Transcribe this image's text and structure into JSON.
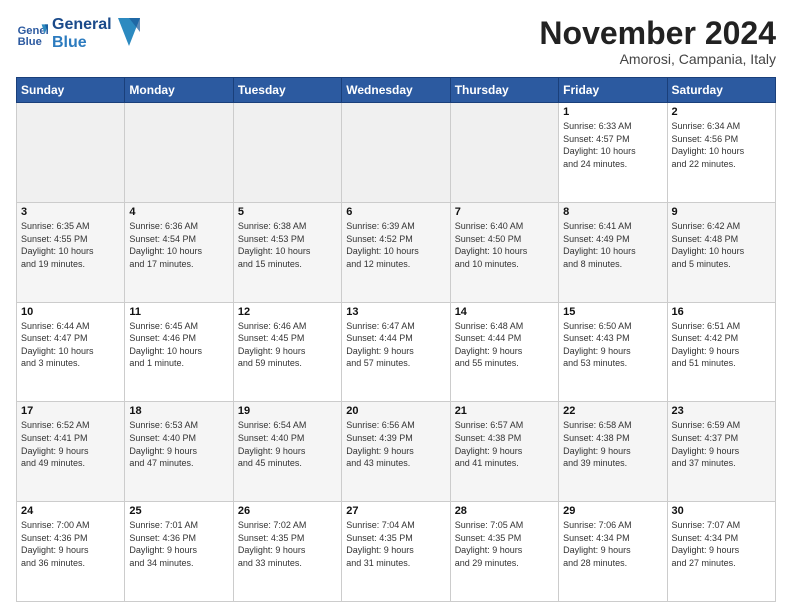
{
  "logo": {
    "line1": "General",
    "line2": "Blue"
  },
  "title": "November 2024",
  "subtitle": "Amorosi, Campania, Italy",
  "days_of_week": [
    "Sunday",
    "Monday",
    "Tuesday",
    "Wednesday",
    "Thursday",
    "Friday",
    "Saturday"
  ],
  "weeks": [
    [
      {
        "day": "",
        "detail": ""
      },
      {
        "day": "",
        "detail": ""
      },
      {
        "day": "",
        "detail": ""
      },
      {
        "day": "",
        "detail": ""
      },
      {
        "day": "",
        "detail": ""
      },
      {
        "day": "1",
        "detail": "Sunrise: 6:33 AM\nSunset: 4:57 PM\nDaylight: 10 hours\nand 24 minutes."
      },
      {
        "day": "2",
        "detail": "Sunrise: 6:34 AM\nSunset: 4:56 PM\nDaylight: 10 hours\nand 22 minutes."
      }
    ],
    [
      {
        "day": "3",
        "detail": "Sunrise: 6:35 AM\nSunset: 4:55 PM\nDaylight: 10 hours\nand 19 minutes."
      },
      {
        "day": "4",
        "detail": "Sunrise: 6:36 AM\nSunset: 4:54 PM\nDaylight: 10 hours\nand 17 minutes."
      },
      {
        "day": "5",
        "detail": "Sunrise: 6:38 AM\nSunset: 4:53 PM\nDaylight: 10 hours\nand 15 minutes."
      },
      {
        "day": "6",
        "detail": "Sunrise: 6:39 AM\nSunset: 4:52 PM\nDaylight: 10 hours\nand 12 minutes."
      },
      {
        "day": "7",
        "detail": "Sunrise: 6:40 AM\nSunset: 4:50 PM\nDaylight: 10 hours\nand 10 minutes."
      },
      {
        "day": "8",
        "detail": "Sunrise: 6:41 AM\nSunset: 4:49 PM\nDaylight: 10 hours\nand 8 minutes."
      },
      {
        "day": "9",
        "detail": "Sunrise: 6:42 AM\nSunset: 4:48 PM\nDaylight: 10 hours\nand 5 minutes."
      }
    ],
    [
      {
        "day": "10",
        "detail": "Sunrise: 6:44 AM\nSunset: 4:47 PM\nDaylight: 10 hours\nand 3 minutes."
      },
      {
        "day": "11",
        "detail": "Sunrise: 6:45 AM\nSunset: 4:46 PM\nDaylight: 10 hours\nand 1 minute."
      },
      {
        "day": "12",
        "detail": "Sunrise: 6:46 AM\nSunset: 4:45 PM\nDaylight: 9 hours\nand 59 minutes."
      },
      {
        "day": "13",
        "detail": "Sunrise: 6:47 AM\nSunset: 4:44 PM\nDaylight: 9 hours\nand 57 minutes."
      },
      {
        "day": "14",
        "detail": "Sunrise: 6:48 AM\nSunset: 4:44 PM\nDaylight: 9 hours\nand 55 minutes."
      },
      {
        "day": "15",
        "detail": "Sunrise: 6:50 AM\nSunset: 4:43 PM\nDaylight: 9 hours\nand 53 minutes."
      },
      {
        "day": "16",
        "detail": "Sunrise: 6:51 AM\nSunset: 4:42 PM\nDaylight: 9 hours\nand 51 minutes."
      }
    ],
    [
      {
        "day": "17",
        "detail": "Sunrise: 6:52 AM\nSunset: 4:41 PM\nDaylight: 9 hours\nand 49 minutes."
      },
      {
        "day": "18",
        "detail": "Sunrise: 6:53 AM\nSunset: 4:40 PM\nDaylight: 9 hours\nand 47 minutes."
      },
      {
        "day": "19",
        "detail": "Sunrise: 6:54 AM\nSunset: 4:40 PM\nDaylight: 9 hours\nand 45 minutes."
      },
      {
        "day": "20",
        "detail": "Sunrise: 6:56 AM\nSunset: 4:39 PM\nDaylight: 9 hours\nand 43 minutes."
      },
      {
        "day": "21",
        "detail": "Sunrise: 6:57 AM\nSunset: 4:38 PM\nDaylight: 9 hours\nand 41 minutes."
      },
      {
        "day": "22",
        "detail": "Sunrise: 6:58 AM\nSunset: 4:38 PM\nDaylight: 9 hours\nand 39 minutes."
      },
      {
        "day": "23",
        "detail": "Sunrise: 6:59 AM\nSunset: 4:37 PM\nDaylight: 9 hours\nand 37 minutes."
      }
    ],
    [
      {
        "day": "24",
        "detail": "Sunrise: 7:00 AM\nSunset: 4:36 PM\nDaylight: 9 hours\nand 36 minutes."
      },
      {
        "day": "25",
        "detail": "Sunrise: 7:01 AM\nSunset: 4:36 PM\nDaylight: 9 hours\nand 34 minutes."
      },
      {
        "day": "26",
        "detail": "Sunrise: 7:02 AM\nSunset: 4:35 PM\nDaylight: 9 hours\nand 33 minutes."
      },
      {
        "day": "27",
        "detail": "Sunrise: 7:04 AM\nSunset: 4:35 PM\nDaylight: 9 hours\nand 31 minutes."
      },
      {
        "day": "28",
        "detail": "Sunrise: 7:05 AM\nSunset: 4:35 PM\nDaylight: 9 hours\nand 29 minutes."
      },
      {
        "day": "29",
        "detail": "Sunrise: 7:06 AM\nSunset: 4:34 PM\nDaylight: 9 hours\nand 28 minutes."
      },
      {
        "day": "30",
        "detail": "Sunrise: 7:07 AM\nSunset: 4:34 PM\nDaylight: 9 hours\nand 27 minutes."
      }
    ]
  ]
}
